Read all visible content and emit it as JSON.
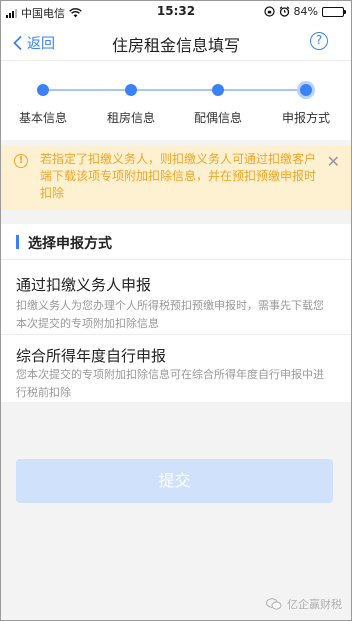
{
  "status_bar": {
    "carrier": "中国电信",
    "time": "15:32",
    "battery": "84%",
    "battery_level": 0.84,
    "battery_color": "#3ec23e"
  },
  "nav": {
    "back_label": "返回",
    "title": "住房租金信息填写",
    "help_icon": "?"
  },
  "colors": {
    "accent": "#3b82f6",
    "warning": "#f2a623",
    "notice_bg": "#fdf1d2",
    "submit_disabled": "#cfe1fb"
  },
  "stepper": {
    "steps": [
      {
        "label": "基本信息"
      },
      {
        "label": "租房信息"
      },
      {
        "label": "配偶信息"
      },
      {
        "label": "申报方式"
      }
    ],
    "current_step": 4
  },
  "notice": {
    "icon": "!",
    "text": "若指定了扣缴义务人，则扣缴义务人可通过扣缴客户端下载该项专项附加扣除信息，并在预扣预缴申报时扣除",
    "close_icon": "✕"
  },
  "method_section": {
    "title": "选择申报方式",
    "options": [
      {
        "title": "通过扣缴义务人申报",
        "description": "扣缴义务人为您办理个人所得税预扣预缴申报时，需事先下载您本次提交的专项附加扣除信息"
      },
      {
        "title": "综合所得年度自行申报",
        "description": "您本次提交的专项附加扣除信息可在综合所得年度自行申报中进行税前扣除"
      }
    ]
  },
  "submit_label": "提交",
  "watermark": "亿企赢财税"
}
